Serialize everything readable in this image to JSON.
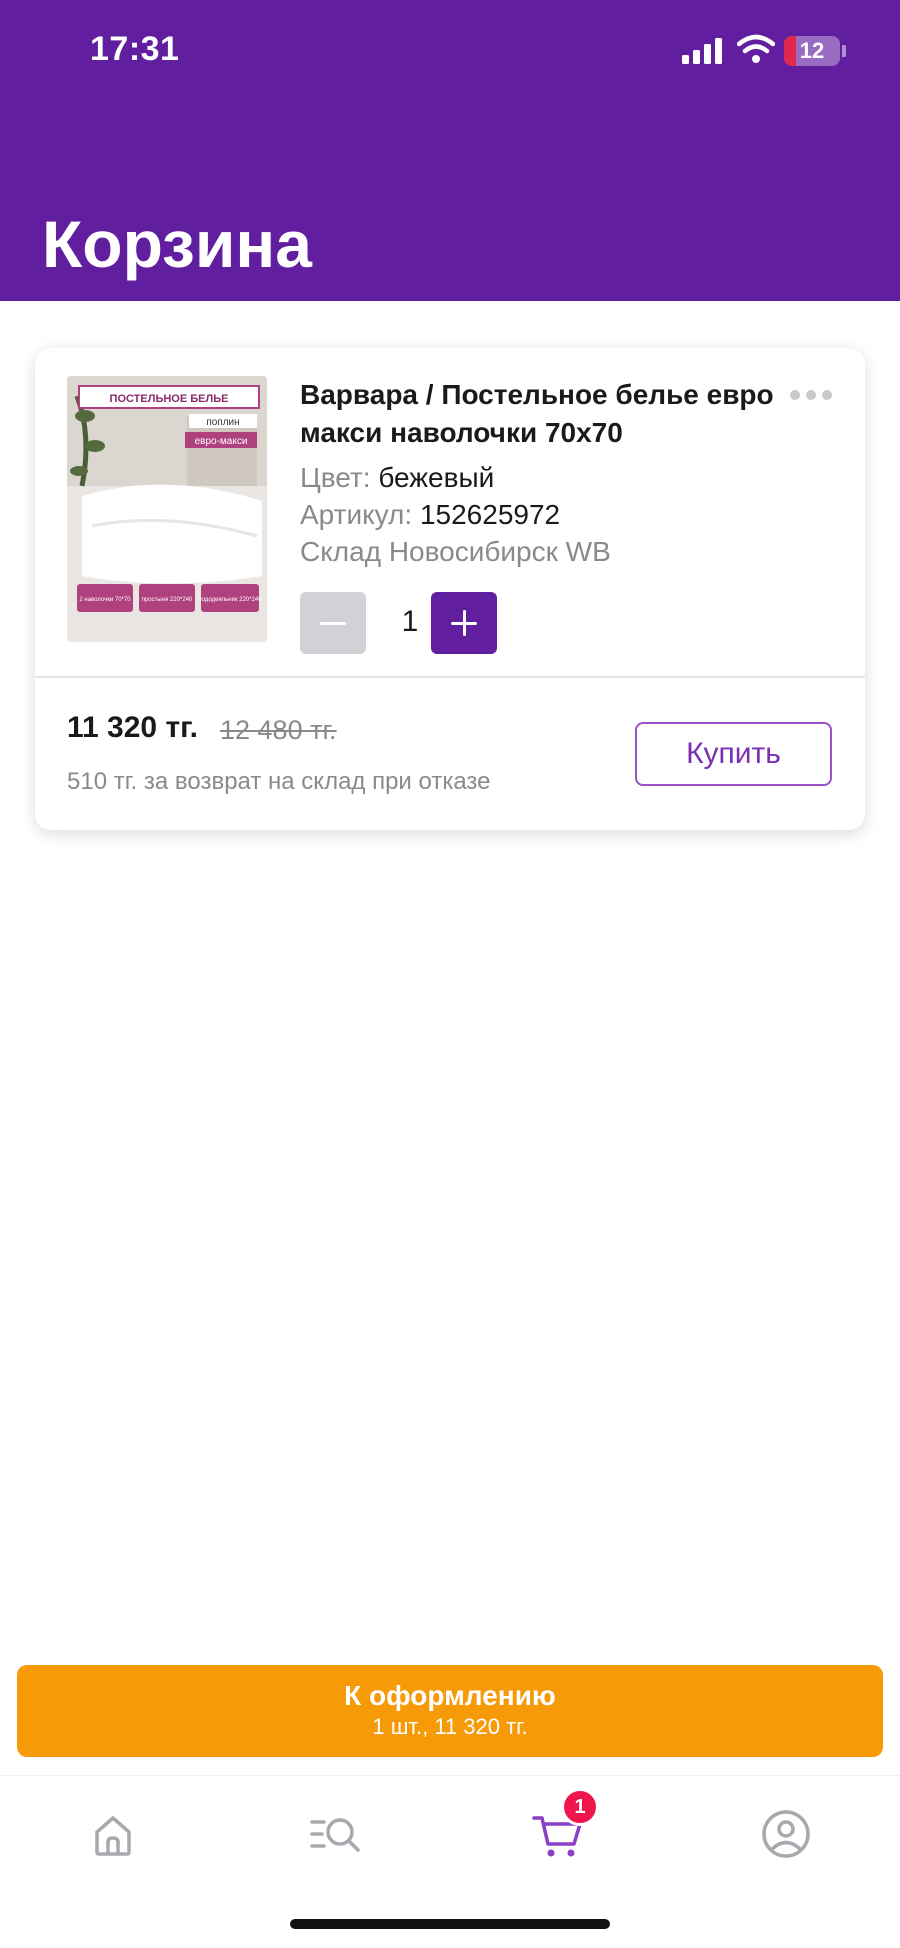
{
  "status_bar": {
    "time": "17:31",
    "battery": "12",
    "icons": [
      "signal-icon",
      "wifi-icon",
      "battery-icon"
    ]
  },
  "header": {
    "title": "Корзина"
  },
  "cart_item": {
    "name": "Варвара / Постельное белье евро макси наволочки 70х70",
    "color_label": "Цвет:",
    "color_value": "бежевый",
    "sku_label": "Артикул:",
    "sku_value": "152625972",
    "warehouse": "Склад Новосибирск WB",
    "quantity": "1",
    "price": "11 320 тг.",
    "old_price": "12 480 тг.",
    "return_note": "510 тг. за возврат на склад при отказе",
    "buy_label": "Купить",
    "thumbnail": {
      "heading": "ПОСТЕЛЬНОЕ БЕЛЬЕ",
      "tag1": "поплин",
      "tag2": "евро-макси",
      "chip1": "2 наволочки 70*70",
      "chip2": "простыня 220*240",
      "chip3": "пододеяльник 220*240"
    }
  },
  "checkout": {
    "title": "К оформлению",
    "subtitle": "1 шт., 11 320 тг."
  },
  "tabbar": {
    "cart_badge": "1",
    "icons": [
      "home-icon",
      "catalog-search-icon",
      "cart-icon",
      "profile-icon"
    ]
  },
  "colors": {
    "brand_purple": "#611fa0",
    "checkout_orange": "#f79a08",
    "badge_red": "#f0164d"
  }
}
